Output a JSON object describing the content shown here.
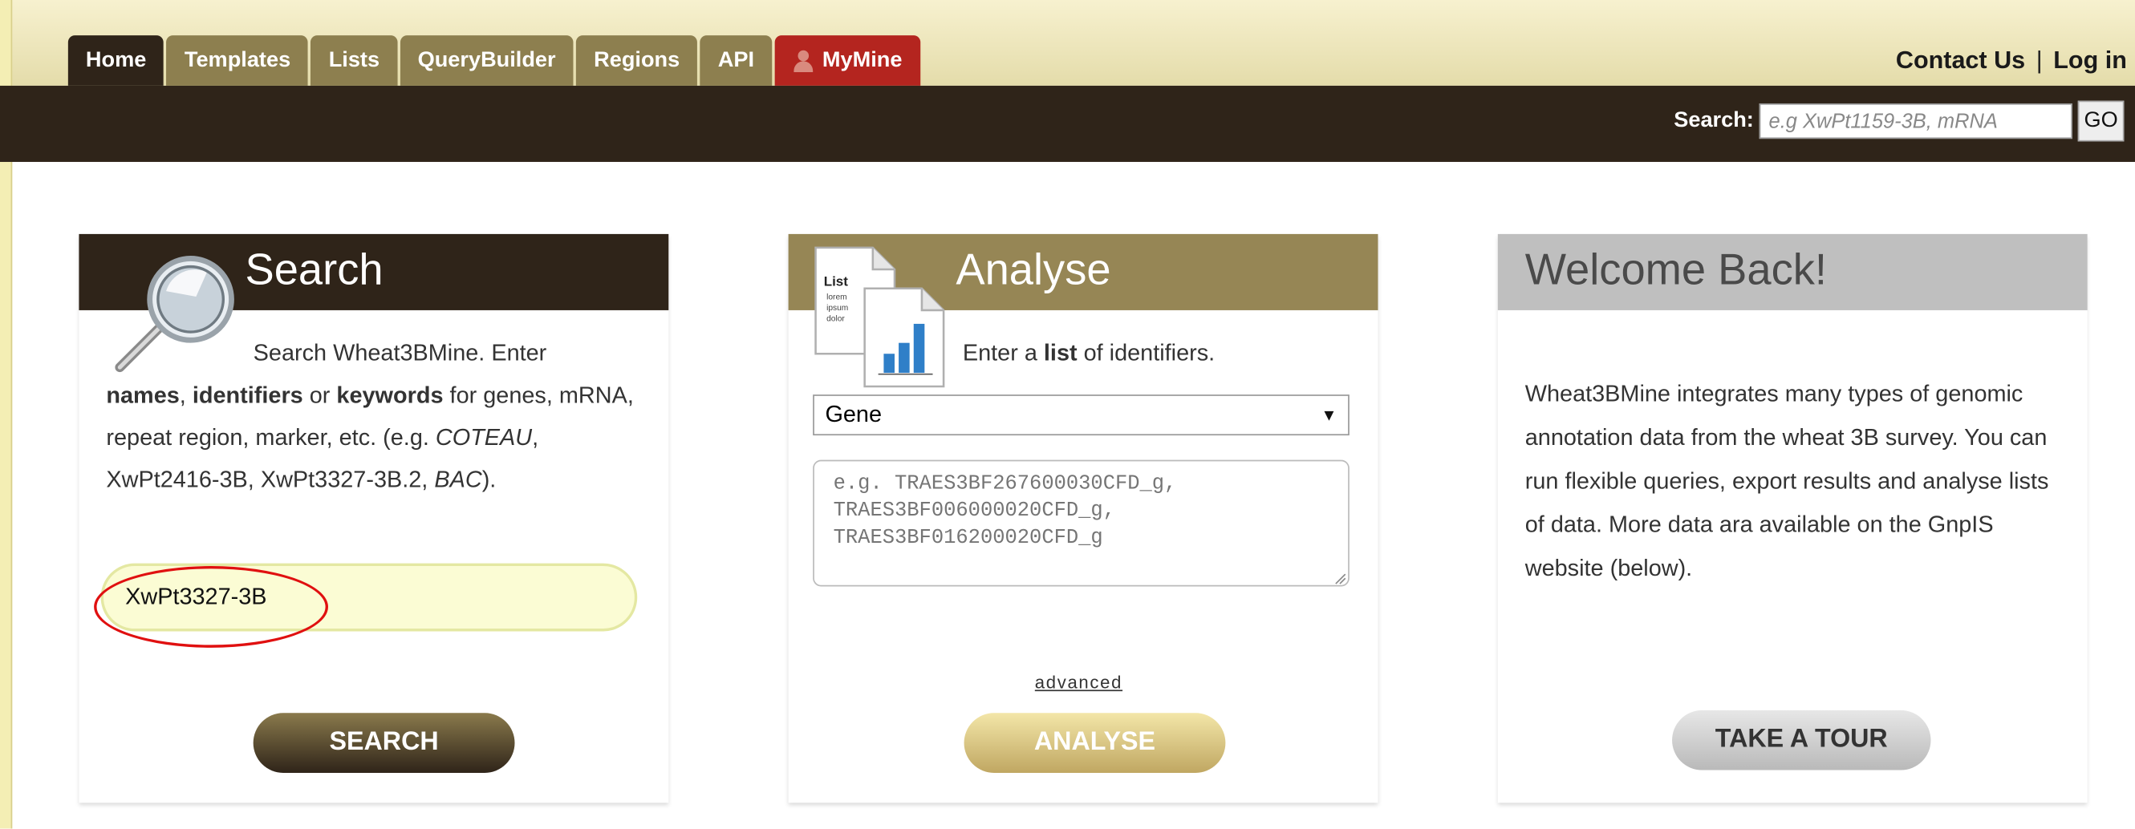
{
  "nav": {
    "tabs": [
      {
        "label": "Home"
      },
      {
        "label": "Templates"
      },
      {
        "label": "Lists"
      },
      {
        "label": "QueryBuilder"
      },
      {
        "label": "Regions"
      },
      {
        "label": "API"
      },
      {
        "label": "MyMine"
      }
    ],
    "contact_label": "Contact Us",
    "separator": "|",
    "login_label": "Log in"
  },
  "quicksearch": {
    "label": "Search:",
    "placeholder": "e.g XwPt1159-3B, mRNA",
    "go_label": "GO"
  },
  "search_card": {
    "title": "Search",
    "desc_line1": "Search Wheat3BMine. Enter",
    "desc_names": "names",
    "desc_sep1": ", ",
    "desc_identifiers": "identifiers",
    "desc_or": " or ",
    "desc_keywords": "keywords",
    "desc_rest": " for genes, mRNA, repeat region, marker, etc. (e.g. ",
    "desc_ex1": "COTEAU",
    "desc_ex_mid": ", XwPt2416-3B, XwPt3327-3B.2, ",
    "desc_ex2": "BAC",
    "desc_end": ").",
    "input_value": "XwPt3327-3B",
    "button_label": "SEARCH"
  },
  "analyse_card": {
    "title": "Analyse",
    "prompt_pre": "Enter a ",
    "prompt_bold": "list",
    "prompt_post": " of identifiers.",
    "select_value": "Gene",
    "textarea_placeholder": "e.g. TRAES3BF267600030CFD_g,\nTRAES3BF006000020CFD_g,\nTRAES3BF016200020CFD_g",
    "advanced_label": "advanced",
    "button_label": "ANALYSE",
    "icon_text": [
      "List",
      "lorem",
      "ipsum",
      "dolor"
    ]
  },
  "welcome_card": {
    "title": "Welcome Back!",
    "text": "Wheat3BMine integrates many types of genomic annotation data from the wheat 3B survey. You can run flexible queries, export results and analyse lists of data. More data ara available on the GnpIS website (below).",
    "button_label": "TAKE A TOUR"
  },
  "colors": {
    "dark_brown": "#2f2419",
    "khaki": "#968655",
    "mymine_red": "#b4251f",
    "highlight_ring": "#e01010"
  }
}
